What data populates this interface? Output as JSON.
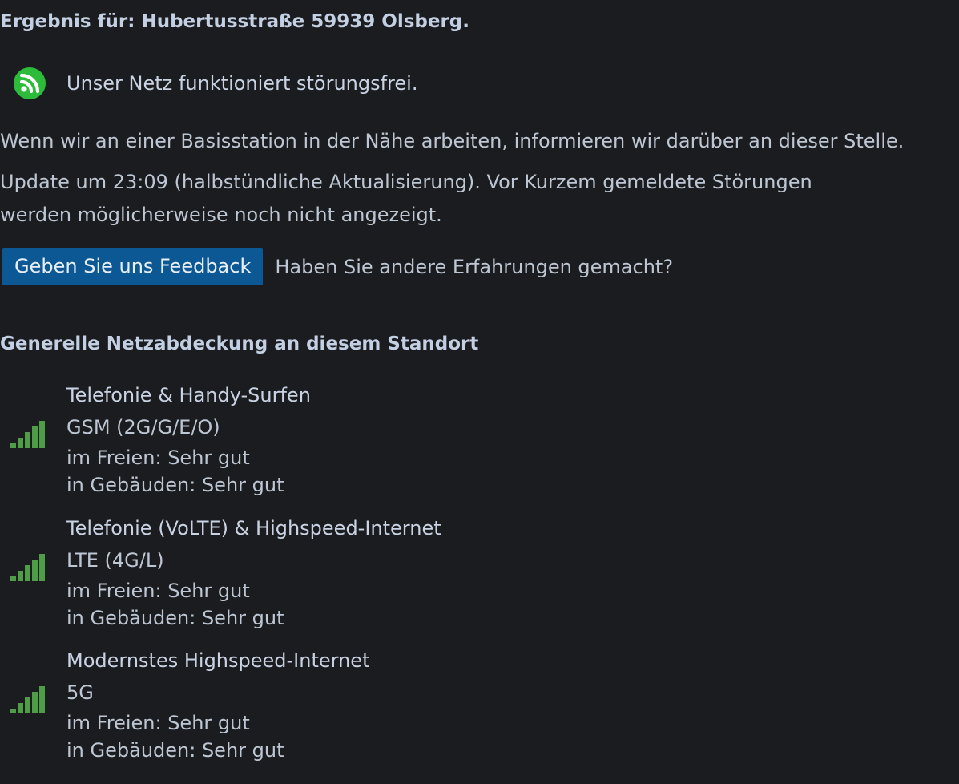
{
  "result": {
    "title": "Ergebnis für: Hubertusstraße 59939 Olsberg."
  },
  "status": {
    "icon": "network-ok-icon",
    "icon_color": "#2dbb3a",
    "text": "Unser Netz funktioniert störungsfrei."
  },
  "info": {
    "maintenance": "Wenn wir an einer Basisstation in der Nähe arbeiten, informieren wir darüber an dieser Stelle.",
    "update": "Update um 23:09 (halbstündliche Aktualisierung). Vor Kurzem gemeldete Störungen werden möglicherweise noch nicht angezeigt."
  },
  "feedback": {
    "button_label": "Geben Sie uns Feedback",
    "hint": "Haben Sie andere Erfahrungen gemacht?",
    "button_color": "#0b5895"
  },
  "coverage": {
    "title": "Generelle Netzabdeckung an diesem Standort",
    "signal_color": "#4f9e47",
    "items": [
      {
        "heading": "Telefonie & Handy-Surfen",
        "technology": "GSM (2G/G/E/O)",
        "outdoor": "im Freien: Sehr gut",
        "indoor": "in Gebäuden: Sehr gut",
        "icon": "signal-strength-icon",
        "signal_bars": 5,
        "signal_max": 5
      },
      {
        "heading": "Telefonie (VoLTE) & Highspeed-Internet",
        "technology": "LTE (4G/L)",
        "outdoor": "im Freien: Sehr gut",
        "indoor": "in Gebäuden: Sehr gut",
        "icon": "signal-strength-icon",
        "signal_bars": 5,
        "signal_max": 5
      },
      {
        "heading": "Modernstes Highspeed-Internet",
        "technology": "5G",
        "outdoor": "im Freien: Sehr gut",
        "indoor": "in Gebäuden: Sehr gut",
        "icon": "signal-strength-icon",
        "signal_bars": 5,
        "signal_max": 5
      }
    ]
  }
}
